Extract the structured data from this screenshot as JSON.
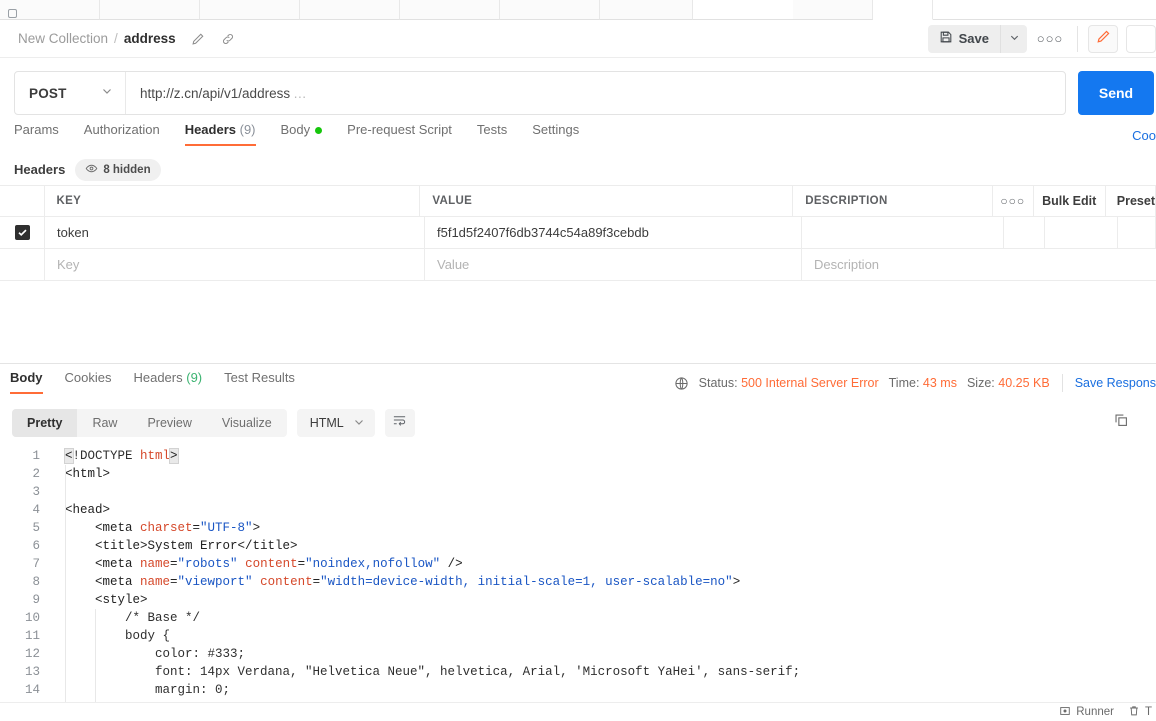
{
  "tabstrip": {
    "note": "partially visible tab bar cut off at top of screenshot"
  },
  "breadcrumb": {
    "collection": "New Collection",
    "separator": "/",
    "request_name": "address",
    "edit_icon": "pencil-icon",
    "link_icon": "link-icon"
  },
  "toolbar": {
    "save_label": "Save",
    "save_icon": "floppy-disk-icon",
    "save_caret_icon": "chevron-down-icon",
    "more_label": "○○○",
    "pencil_icon": "pencil-icon",
    "square_icon": "panel-icon"
  },
  "request": {
    "method": "POST",
    "method_caret_icon": "chevron-down-icon",
    "url": "http://z.cn/api/v1/address",
    "url_ellipsis": "…",
    "send_label": "Send"
  },
  "request_tabs": [
    {
      "label": "Params",
      "active": false
    },
    {
      "label": "Authorization",
      "active": false
    },
    {
      "label": "Headers",
      "count": "(9)",
      "active": true
    },
    {
      "label": "Body",
      "dot": true,
      "active": false
    },
    {
      "label": "Pre-request Script",
      "active": false
    },
    {
      "label": "Tests",
      "active": false
    },
    {
      "label": "Settings",
      "active": false
    }
  ],
  "cookies_link": "Coo",
  "headers_section": {
    "title": "Headers",
    "hidden_badge": "8 hidden",
    "hidden_icon": "eye-icon",
    "columns": [
      "KEY",
      "VALUE",
      "DESCRIPTION"
    ],
    "actions": {
      "more": "○○○",
      "bulk_edit": "Bulk Edit",
      "preset": "Preset"
    },
    "rows": [
      {
        "checked": true,
        "key": "token",
        "value": "f5f1d5f2407f6db3744c54a89f3cebdb",
        "description": ""
      }
    ],
    "placeholder_row": {
      "key": "Key",
      "value": "Value",
      "description": "Description"
    }
  },
  "response_tabs": [
    {
      "label": "Body",
      "active": true
    },
    {
      "label": "Cookies",
      "active": false
    },
    {
      "label": "Headers",
      "count": "(9)",
      "active": false
    },
    {
      "label": "Test Results",
      "active": false
    }
  ],
  "response_meta": {
    "globe_icon": "globe-icon",
    "status_label": "Status:",
    "status_value": "500 Internal Server Error",
    "time_label": "Time:",
    "time_value": "43 ms",
    "size_label": "Size:",
    "size_value": "40.25 KB",
    "save_response": "Save Respons"
  },
  "response_toolbar": {
    "views": [
      {
        "label": "Pretty",
        "active": true
      },
      {
        "label": "Raw",
        "active": false
      },
      {
        "label": "Preview",
        "active": false
      },
      {
        "label": "Visualize",
        "active": false
      }
    ],
    "format": "HTML",
    "format_caret_icon": "chevron-down-icon",
    "wrap_icon": "word-wrap-icon",
    "copy_icon": "copy-icon"
  },
  "code": {
    "lines": [
      {
        "n": "1",
        "tokens": [
          {
            "t": "<",
            "c": "tg hl"
          },
          {
            "t": "!DOCTYPE ",
            "c": "cmt"
          },
          {
            "t": "html",
            "c": "doct"
          },
          {
            "t": ">",
            "c": "tg hl"
          }
        ]
      },
      {
        "n": "2",
        "tokens": [
          {
            "t": "<html>",
            "c": "tg"
          }
        ]
      },
      {
        "n": "3",
        "tokens": []
      },
      {
        "n": "4",
        "tokens": [
          {
            "t": "<head>",
            "c": "tg"
          }
        ]
      },
      {
        "n": "5",
        "tokens": [
          {
            "t": "    <meta ",
            "c": "tg"
          },
          {
            "t": "charset",
            "c": "attr"
          },
          {
            "t": "=",
            "c": "tg"
          },
          {
            "t": "\"UTF-8\"",
            "c": "str"
          },
          {
            "t": ">",
            "c": "tg"
          }
        ]
      },
      {
        "n": "6",
        "tokens": [
          {
            "t": "    <title>System Error</title>",
            "c": "tg"
          }
        ]
      },
      {
        "n": "7",
        "tokens": [
          {
            "t": "    <meta ",
            "c": "tg"
          },
          {
            "t": "name",
            "c": "attr"
          },
          {
            "t": "=",
            "c": "tg"
          },
          {
            "t": "\"robots\"",
            "c": "str"
          },
          {
            "t": " ",
            "c": "tg"
          },
          {
            "t": "content",
            "c": "attr"
          },
          {
            "t": "=",
            "c": "tg"
          },
          {
            "t": "\"noindex,nofollow\"",
            "c": "str"
          },
          {
            "t": " />",
            "c": "tg"
          }
        ]
      },
      {
        "n": "8",
        "tokens": [
          {
            "t": "    <meta ",
            "c": "tg"
          },
          {
            "t": "name",
            "c": "attr"
          },
          {
            "t": "=",
            "c": "tg"
          },
          {
            "t": "\"viewport\"",
            "c": "str"
          },
          {
            "t": " ",
            "c": "tg"
          },
          {
            "t": "content",
            "c": "attr"
          },
          {
            "t": "=",
            "c": "tg"
          },
          {
            "t": "\"width=device-width, initial-scale=1, user-scalable=no\"",
            "c": "str"
          },
          {
            "t": ">",
            "c": "tg"
          }
        ]
      },
      {
        "n": "9",
        "tokens": [
          {
            "t": "    <style>",
            "c": "tg"
          }
        ]
      },
      {
        "n": "10",
        "tokens": [
          {
            "t": "        /* Base */",
            "c": "cmt"
          }
        ]
      },
      {
        "n": "11",
        "tokens": [
          {
            "t": "        body {",
            "c": "cmt"
          }
        ]
      },
      {
        "n": "12",
        "tokens": [
          {
            "t": "            color: #333;",
            "c": "cmt"
          }
        ]
      },
      {
        "n": "13",
        "tokens": [
          {
            "t": "            font: 14px Verdana, \"Helvetica Neue\", helvetica, Arial, 'Microsoft YaHei', sans-serif;",
            "c": "cmt"
          }
        ]
      },
      {
        "n": "14",
        "tokens": [
          {
            "t": "            margin: 0;",
            "c": "cmt"
          }
        ]
      }
    ]
  },
  "statusbar": {
    "runner_label": "Runner",
    "runner_icon": "runner-icon",
    "trash_label": "T",
    "trash_icon": "trash-icon"
  },
  "colors": {
    "accent_orange": "#ff6c37",
    "send_blue": "#1478f0",
    "link_blue": "#1a6fe0",
    "status_error": "#ff6c37",
    "body_dot_green": "#16c60c"
  }
}
